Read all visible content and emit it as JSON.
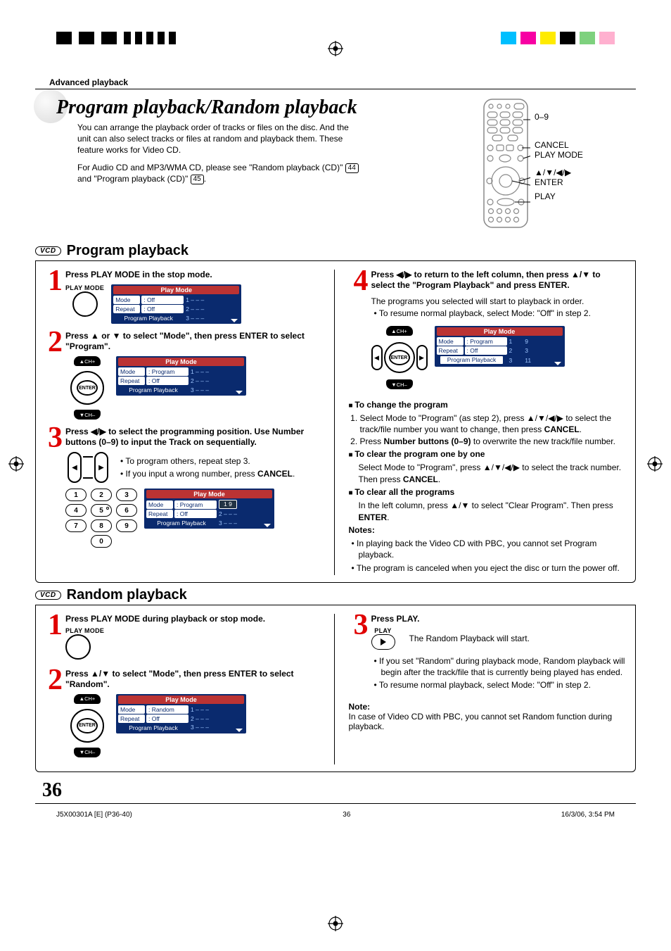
{
  "header": {
    "section": "Advanced playback"
  },
  "title": "Program playback/Random playback",
  "intro": {
    "p1": "You can arrange the playback order of tracks or files on the disc. And the unit can also select tracks or files at random and playback them. These feature works for Video CD.",
    "p2a": "For Audio CD and MP3/WMA CD, please see \"Random playback (CD)\" ",
    "p2b": " and \"Program playback (CD)\" ",
    "p2c": ".",
    "ref1": "44",
    "ref2": "45"
  },
  "remote": {
    "r1": "0–9",
    "r2": "CANCEL",
    "r3": "PLAY MODE",
    "r4": "▲/▼/◀/▶",
    "r5": "ENTER",
    "r6": "PLAY"
  },
  "vcd": "VCD",
  "program": {
    "title": "Program playback",
    "s1": {
      "head": "Press PLAY MODE in the stop mode.",
      "btn": "PLAY MODE",
      "osd": {
        "title": "Play Mode",
        "mode": "Mode",
        "modev": ": Off",
        "repeat": "Repeat",
        "repeatv": ": Off",
        "pp": "Program Playback",
        "r1": "1   – – –",
        "r2": "2   – – –",
        "r3": "3   – – –"
      }
    },
    "s2": {
      "head": "Press ▲ or ▼ to select \"Mode\", then press ENTER to select \"Program\".",
      "chtop": "▲CH+",
      "chbot": "▼CH–",
      "enter": "ENTER",
      "osd": {
        "title": "Play Mode",
        "mode": "Mode",
        "modev": ": Program",
        "repeat": "Repeat",
        "repeatv": ": Off",
        "pp": "Program Playback",
        "r1": "1   – – –",
        "r2": "2   – – –",
        "r3": "3   – – –"
      }
    },
    "s3": {
      "head": "Press ◀/▶ to select the programming position. Use Number buttons (0–9) to input the Track on sequentially.",
      "b1": "To program others, repeat step 3.",
      "b2a": "If you input a wrong number, press ",
      "b2b": "CANCEL",
      "b2c": ".",
      "osd": {
        "title": "Play Mode",
        "mode": "Mode",
        "modev": ": Program",
        "repeat": "Repeat",
        "repeatv": ": Off",
        "pp": "Program Playback",
        "rhl": "1        9",
        "r2": "2   – – –",
        "r3": "3   – – –"
      },
      "nums": [
        "1",
        "2",
        "3",
        "4",
        "5",
        "6",
        "7",
        "8",
        "9",
        "0"
      ]
    },
    "s4": {
      "head": "Press ◀/▶ to return to the left column, then press ▲/▼ to select the \"Program Playback\" and press ENTER.",
      "p1": "The programs you selected will start to playback in order.",
      "b1": "To resume normal playback, select Mode: \"Off\" in step 2.",
      "chtop": "▲CH+",
      "chbot": "▼CH–",
      "enter": "ENTER",
      "osd": {
        "title": "Play Mode",
        "mode": "Mode",
        "modev": ": Program",
        "repeat": "Repeat",
        "repeatv": ": Off",
        "pp": "Program Playback",
        "c1a": "1",
        "c1b": "9",
        "c2a": "2",
        "c2b": "3",
        "c3a": "3",
        "c3b": "11"
      }
    },
    "extra": {
      "h1": "To change the program",
      "e1a": "Select Mode to \"Program\" (as step 2), press ▲/▼/◀/▶ to select the track/file number you want to change, then press ",
      "e1b": "CANCEL",
      "e1c": ".",
      "e2a": "Press ",
      "e2b": "Number buttons (0–9)",
      "e2c": " to overwrite the new track/file number.",
      "h2": "To clear the program one by one",
      "e3a": "Select Mode to \"Program\", press ▲/▼/◀/▶ to select the track number. Then press ",
      "e3b": "CANCEL",
      "e3c": ".",
      "h3": "To clear all the programs",
      "e4a": "In the left column, press ▲/▼ to select \"Clear Program\". Then press ",
      "e4b": "ENTER",
      "e4c": ".",
      "notes": "Notes:",
      "n1": "In playing back the Video CD with PBC, you cannot set Program playback.",
      "n2": "The program is canceled when you eject the disc or turn the power off."
    }
  },
  "random": {
    "title": "Random playback",
    "s1": {
      "head": "Press PLAY MODE during playback or stop mode.",
      "btn": "PLAY MODE"
    },
    "s2": {
      "head": "Press ▲/▼ to select \"Mode\", then press ENTER to select \"Random\".",
      "chtop": "▲CH+",
      "chbot": "▼CH–",
      "enter": "ENTER",
      "osd": {
        "title": "Play Mode",
        "mode": "Mode",
        "modev": ": Random",
        "repeat": "Repeat",
        "repeatv": ": Off",
        "pp": "Program Playback",
        "r1": "1   – – –",
        "r2": "2   – – –",
        "r3": "3   – – –"
      }
    },
    "s3": {
      "head": "Press PLAY.",
      "btn": "PLAY",
      "p1": "The Random Playback will start.",
      "b1": "If you set \"Random\" during playback mode, Random playback will begin after the track/file that is currently being played has ended.",
      "b2": "To resume normal playback, select Mode: \"Off\" in step 2."
    },
    "note": {
      "h": "Note:",
      "t": "In case of Video CD with PBC, you cannot set Random function during playback."
    }
  },
  "page_number": "36",
  "footer": {
    "left": "J5X00301A [E] (P36-40)",
    "mid": "36",
    "right": "16/3/06, 3:54 PM"
  }
}
